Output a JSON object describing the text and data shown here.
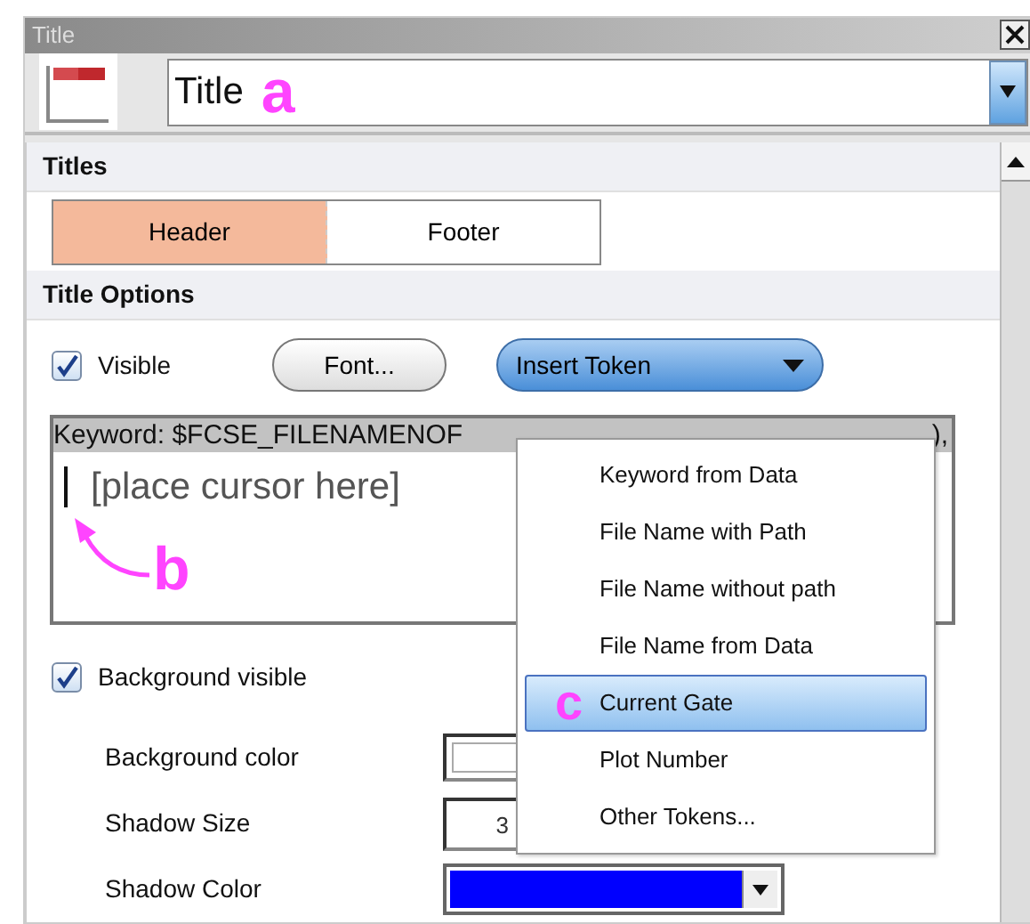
{
  "window": {
    "title": "Title"
  },
  "title_combo": {
    "value": "Title"
  },
  "annotations": [
    {
      "label": "a"
    },
    {
      "label": "b"
    },
    {
      "label": "c"
    }
  ],
  "titles_section": {
    "heading": "Titles",
    "tabs": [
      {
        "label": "Header",
        "selected": true
      },
      {
        "label": "Footer",
        "selected": false
      }
    ]
  },
  "options_section": {
    "heading": "Title Options",
    "visible": {
      "label": "Visible",
      "checked": true
    },
    "font_button": "Font...",
    "insert_token": {
      "label": "Insert Token",
      "expanded": true,
      "items": [
        {
          "label": "Keyword from Data",
          "selected": false
        },
        {
          "label": "File Name with Path",
          "selected": false
        },
        {
          "label": "File Name without path",
          "selected": false
        },
        {
          "label": "File Name from Data",
          "selected": false
        },
        {
          "label": "Current Gate",
          "selected": true
        },
        {
          "label": "Plot Number",
          "selected": false
        },
        {
          "label": "Other Tokens...",
          "selected": false
        }
      ]
    },
    "editor": {
      "keyword_start": "Keyword: $FCSE_FILENAMENOF",
      "keyword_end": "),",
      "line": "[place cursor here]"
    },
    "background_visible": {
      "label": "Background visible",
      "checked": true
    },
    "fields": [
      {
        "kind": "swatch",
        "label": "Background color",
        "color": "#ffffff"
      },
      {
        "kind": "number",
        "label": "Shadow Size",
        "value": "3"
      },
      {
        "kind": "color-dropdown",
        "label": "Shadow Color",
        "color": "#0000ff"
      }
    ]
  }
}
